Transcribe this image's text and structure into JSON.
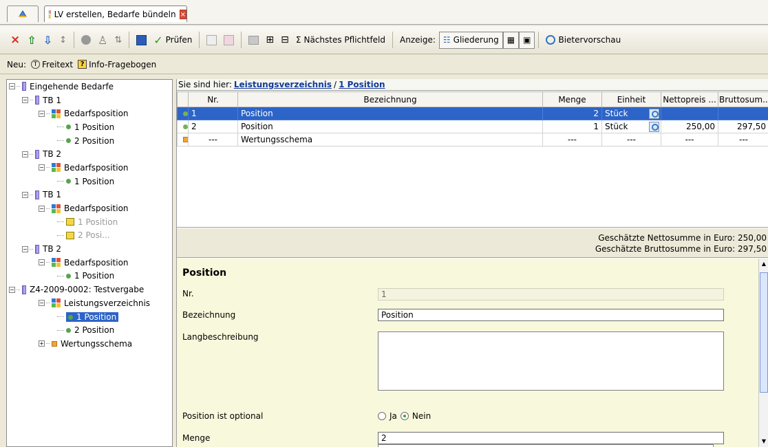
{
  "tabs": {
    "home_icon": "home-icon",
    "main_label": "LV erstellen, Bedarfe bündeln",
    "close_icon": "close-icon"
  },
  "toolbar": {
    "pruefen": "Prüfen",
    "next_required": "Nächstes Pflichtfeld",
    "anzeige": "Anzeige:",
    "gliederung": "Gliederung",
    "bietervorschau": "Bietervorschau"
  },
  "neubar": {
    "label": "Neu:",
    "freitext": "Freitext",
    "infofragebogen": "Info-Fragebogen"
  },
  "tree": [
    {
      "label": "Eingehende Bedarfe"
    },
    {
      "label": "TB 1"
    },
    {
      "label": "Bedarfsposition"
    },
    {
      "label": "1 Position"
    },
    {
      "label": "2 Position"
    },
    {
      "label": "TB 2"
    },
    {
      "label": "Bedarfsposition"
    },
    {
      "label": "1 Position"
    },
    {
      "label": "TB 1"
    },
    {
      "label": "Bedarfsposition"
    },
    {
      "label": "1 Position"
    },
    {
      "label": "2 Posi..."
    },
    {
      "label": "TB 2"
    },
    {
      "label": "Bedarfsposition"
    },
    {
      "label": "1 Position"
    },
    {
      "label": "Z4-2009-0002: Testvergabe"
    },
    {
      "label": "Leistungsverzeichnis"
    },
    {
      "label": "1 Position"
    },
    {
      "label": "2 Position"
    },
    {
      "label": "Wertungsschema"
    }
  ],
  "breadcrumb": {
    "prefix": "Sie sind hier:",
    "first": "Leistungsverzeichnis",
    "separator": "/",
    "second": "1 Position"
  },
  "table": {
    "columns": [
      "Nr.",
      "Bezeichnung",
      "Menge",
      "Einheit",
      "Nettopreis ...",
      "Bruttosum..."
    ],
    "rows": [
      {
        "nr": "1",
        "bezeichnung": "Position",
        "menge": "2",
        "einheit": "Stück",
        "netto": "",
        "brutto": ""
      },
      {
        "nr": "2",
        "bezeichnung": "Position",
        "menge": "1",
        "einheit": "Stück",
        "netto": "250,00",
        "brutto": "297,50"
      },
      {
        "nr": "---",
        "bezeichnung": "Wertungsschema",
        "menge": "---",
        "einheit": "---",
        "netto": "---",
        "brutto": "---"
      }
    ]
  },
  "summary": {
    "netto": "Geschätzte Nettosumme in Euro: 250,00",
    "brutto": "Geschätzte Bruttosumme in Euro: 297,50"
  },
  "detail": {
    "title": "Position",
    "labels": {
      "nr": "Nr.",
      "bezeichnung": "Bezeichnung",
      "langbeschreibung": "Langbeschreibung",
      "optional": "Position ist optional",
      "menge": "Menge"
    },
    "values": {
      "nr": "1",
      "bezeichnung": "Position",
      "langbeschreibung": "",
      "menge": "2"
    },
    "radio": {
      "ja": "Ja",
      "nein": "Nein"
    }
  }
}
